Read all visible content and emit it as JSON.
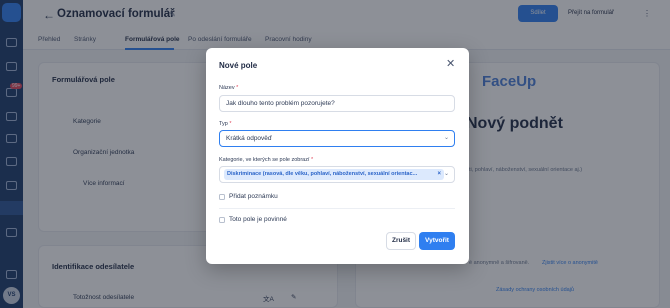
{
  "header": {
    "title": "Oznamovací formulář",
    "share_label": "Sdílet",
    "goto_label": "Přejít na formulář"
  },
  "tabs": [
    {
      "label": "Přehled"
    },
    {
      "label": "Stránky"
    },
    {
      "label": "Formulářová pole"
    },
    {
      "label": "Po odeslání formuláře"
    },
    {
      "label": "Pracovní hodiny"
    }
  ],
  "rail": {
    "badge": "99+",
    "avatar": "VS"
  },
  "left_panel": {
    "title": "Formulářová pole",
    "items": [
      {
        "label": "Kategorie",
        "required": "*"
      },
      {
        "label": "Organizační jednotka",
        "required": "*"
      },
      {
        "label": "Více informací",
        "required": "*"
      }
    ]
  },
  "sender_panel": {
    "title": "Identifikace odesílatele",
    "item": "Totožnost odesílatele"
  },
  "preview": {
    "logo": "FaceUp",
    "heading": "Nový podnět",
    "line1": "ti, pohlaví, náboženství, sexuální orientace aj.)",
    "line2": "é anonymně a šifrovaně.",
    "link1": "Zjistit více o anonymitě",
    "link2": "Zásady ochrany osobních údajů"
  },
  "modal": {
    "title": "Nové pole",
    "name_label": "Název",
    "name_value": "Jak dlouho tento problém pozorujete?",
    "type_label": "Typ",
    "type_value": "Krátká odpověď",
    "categories_label": "Kategorie, ve kterých se pole zobrazí",
    "categories_chip": "Diskriminace (rasová, dle věku, pohlaví, náboženství, sexuální orientac...",
    "add_note_label": "Přidat poznámku",
    "required_label": "Toto pole je povinné",
    "cancel_label": "Zrušit",
    "create_label": "Vytvořit",
    "required_mark": "*"
  }
}
